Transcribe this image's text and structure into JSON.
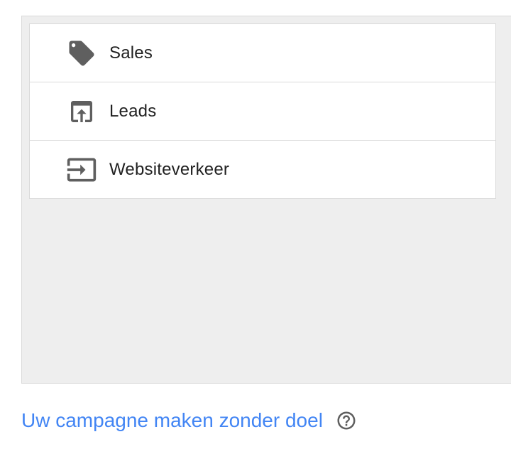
{
  "goals": {
    "items": [
      {
        "label": "Sales",
        "icon": "tag-icon"
      },
      {
        "label": "Leads",
        "icon": "upload-window-icon"
      },
      {
        "label": "Websiteverkeer",
        "icon": "enter-icon"
      }
    ]
  },
  "footer": {
    "link_label": "Uw campagne maken zonder doel",
    "help_icon": "help-circle-icon"
  },
  "colors": {
    "panel_bg": "#eeeeee",
    "icon": "#5f5f5f",
    "link": "#4285f4",
    "text": "#212121"
  }
}
